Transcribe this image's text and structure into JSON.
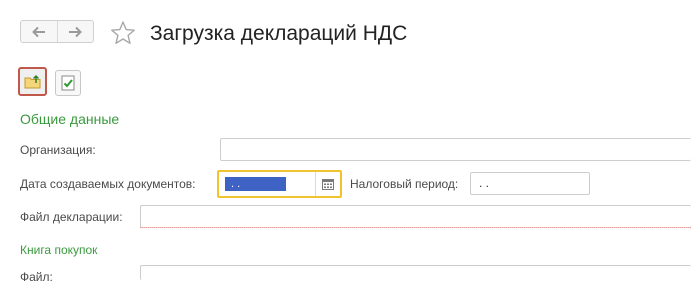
{
  "window": {
    "title": "Загрузка деклараций НДС",
    "icons": {
      "back": "arrow-left-icon",
      "forward": "arrow-right-icon",
      "favorite": "star-icon"
    }
  },
  "toolbar": {
    "buttons": [
      {
        "icon": "folder-upload-icon",
        "active": true
      },
      {
        "icon": "document-check-icon",
        "active": false
      }
    ]
  },
  "general": {
    "heading": "Общие данные",
    "organization_label": "Организация:",
    "organization_value": "",
    "doc_date_label": "Дата создаваемых документов:",
    "doc_date_value": " .  .",
    "tax_period_label": "Налоговый период:",
    "tax_period_value": ".  .",
    "declaration_file_label": "Файл декларации:",
    "declaration_file_value": ""
  },
  "purchase_book": {
    "heading": "Книга покупок",
    "file_label": "Файл:",
    "file_value": ""
  },
  "colors": {
    "accent_green": "#3a9a3e",
    "focus_yellow": "#f2c331",
    "selection_blue": "#3f62c5",
    "active_border": "#c0584b"
  }
}
